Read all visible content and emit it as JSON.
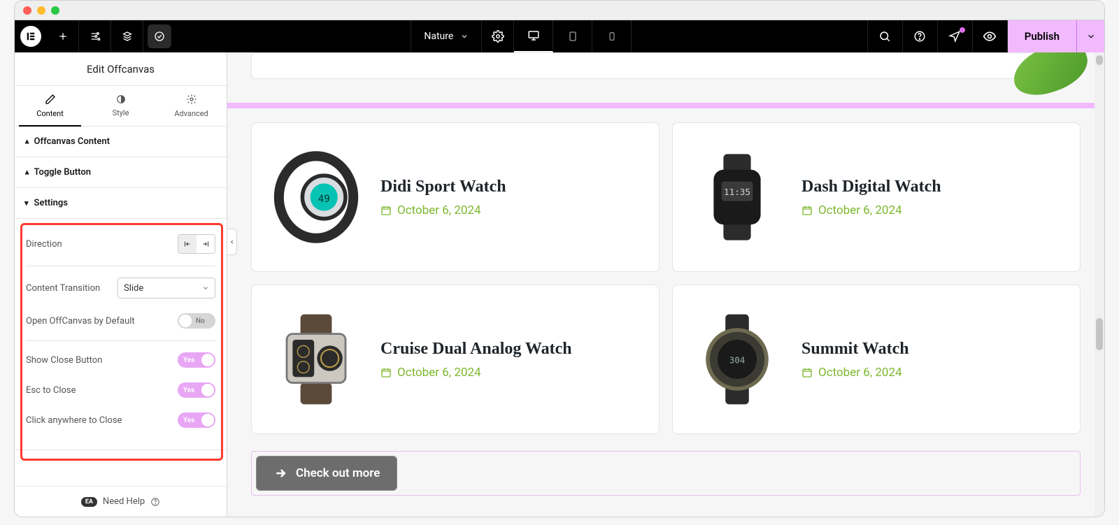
{
  "topbar": {
    "page_name": "Nature",
    "publish_label": "Publish"
  },
  "panel": {
    "title": "Edit Offcanvas",
    "tabs": {
      "content": "Content",
      "style": "Style",
      "advanced": "Advanced"
    },
    "sections": {
      "offcanvas_content": "Offcanvas Content",
      "toggle_button": "Toggle Button",
      "settings": "Settings"
    },
    "settings": {
      "direction_label": "Direction",
      "content_transition_label": "Content Transition",
      "content_transition_value": "Slide",
      "open_default_label": "Open OffCanvas by Default",
      "open_default_value": "No",
      "show_close_label": "Show Close Button",
      "show_close_value": "Yes",
      "esc_close_label": "Esc to Close",
      "esc_close_value": "Yes",
      "click_close_label": "Click anywhere to Close",
      "click_close_value": "Yes"
    },
    "footer": {
      "badge": "EA",
      "help": "Need Help"
    }
  },
  "canvas": {
    "cards": [
      {
        "title": "Didi Sport Watch",
        "date": "October 6, 2024"
      },
      {
        "title": "Dash Digital Watch",
        "date": "October 6, 2024"
      },
      {
        "title": "Cruise Dual Analog Watch",
        "date": "October 6, 2024"
      },
      {
        "title": "Summit Watch",
        "date": "October 6, 2024"
      }
    ],
    "cta_label": "Check out more"
  }
}
